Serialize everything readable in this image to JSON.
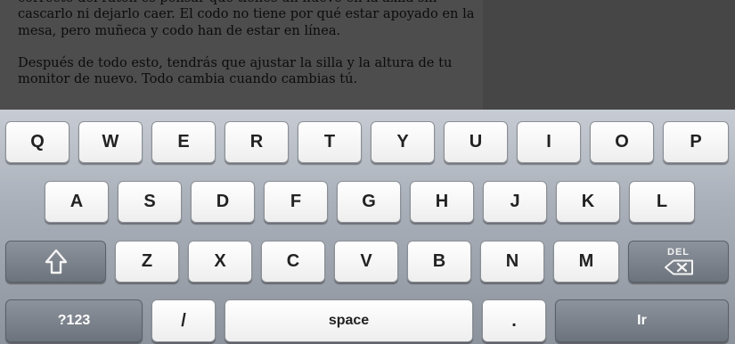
{
  "document": {
    "paragraphs": [
      "correcto del ratón es pensar que tienes un huevo en la axila sin cascarlo ni dejarlo caer. El codo no tiene por qué estar apoyado en la mesa, pero muñeca y codo han de estar en línea.",
      "Después de todo esto, tendrás que ajustar la silla y la altura de tu monitor de nuevo. Todo cambia cuando cambias tú."
    ]
  },
  "keyboard": {
    "row1": [
      "Q",
      "W",
      "E",
      "R",
      "T",
      "Y",
      "U",
      "I",
      "O",
      "P"
    ],
    "row2": [
      "A",
      "S",
      "D",
      "F",
      "G",
      "H",
      "J",
      "K",
      "L"
    ],
    "row3": [
      "Z",
      "X",
      "C",
      "V",
      "B",
      "N",
      "M"
    ],
    "shift_icon": "shift-arrow-icon",
    "delete_label": "DEL",
    "delete_icon": "backspace-icon",
    "symbols_label": "?123",
    "slash_label": "/",
    "space_label": "space",
    "period_label": ".",
    "enter_label": "Ir"
  }
}
